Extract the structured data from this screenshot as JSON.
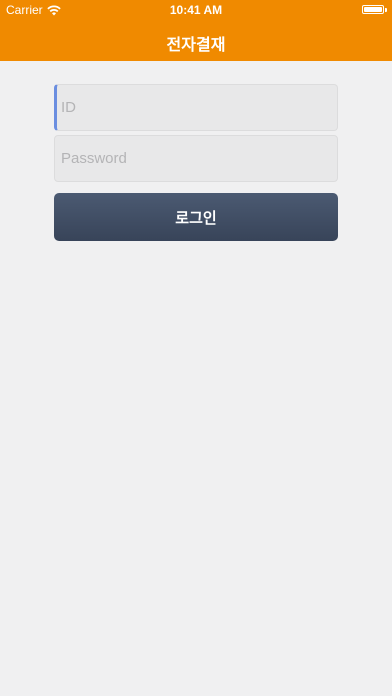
{
  "status_bar": {
    "carrier": "Carrier",
    "time": "10:41 AM",
    "wifi_icon": "wifi-icon",
    "battery_icon": "battery-icon",
    "battery_level": 1.0
  },
  "header": {
    "title": "전자결재",
    "background_color": "#f08a00"
  },
  "login_form": {
    "id_field": {
      "value": "",
      "placeholder": "ID"
    },
    "password_field": {
      "value": "",
      "placeholder": "Password"
    },
    "login_button": {
      "label": "로그인",
      "color": "#414e64"
    }
  }
}
